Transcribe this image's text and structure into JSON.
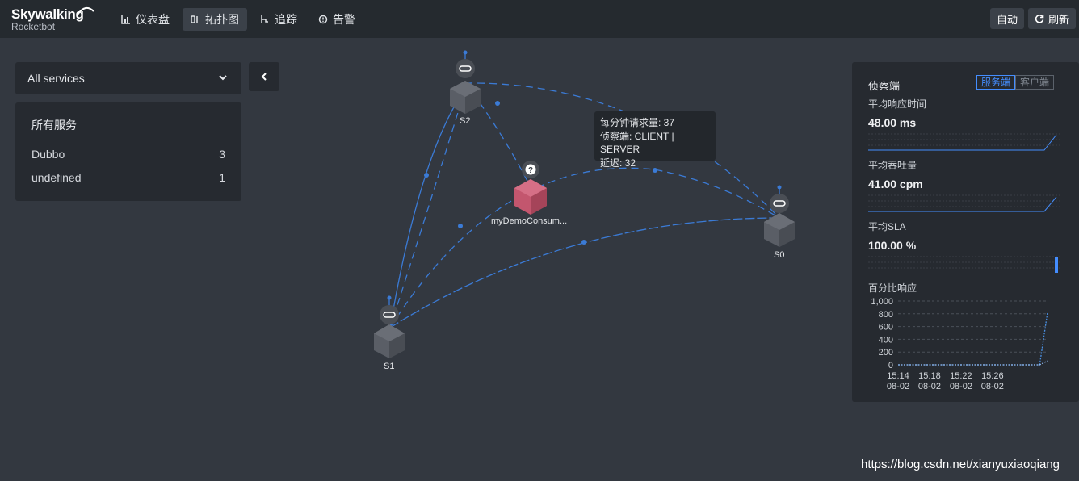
{
  "header": {
    "logo_name": "Skywalking",
    "logo_sub": "Rocketbot",
    "nav": [
      {
        "label": "仪表盘",
        "icon": "dashboard-icon"
      },
      {
        "label": "拓扑图",
        "icon": "topology-icon",
        "active": true
      },
      {
        "label": "追踪",
        "icon": "trace-icon"
      },
      {
        "label": "告警",
        "icon": "alarm-icon"
      }
    ],
    "auto_label": "自动",
    "refresh_label": "刷新"
  },
  "sidebar": {
    "service_select": "All services",
    "panel_title": "所有服务",
    "services": [
      {
        "name": "Dubbo",
        "count": "3"
      },
      {
        "name": "undefined",
        "count": "1"
      }
    ]
  },
  "topology": {
    "nodes": [
      {
        "label": "S2",
        "type": "dubbo"
      },
      {
        "label": "myDemoConsum...",
        "type": "unknown"
      },
      {
        "label": "S0",
        "type": "dubbo"
      },
      {
        "label": "S1",
        "type": "dubbo"
      }
    ],
    "tooltip": {
      "line1": "每分钟请求量: 37",
      "line2": "侦察端: CLIENT | SERVER",
      "line3": "延迟: 32"
    }
  },
  "detail_panel": {
    "title": "侦察端",
    "tabs": [
      "服务端",
      "客户端"
    ],
    "active_tab": "服务端",
    "metrics": [
      {
        "label": "平均响应时间",
        "value": "48.00 ms"
      },
      {
        "label": "平均吞吐量",
        "value": "41.00 cpm"
      },
      {
        "label": "平均SLA",
        "value": "100.00 %"
      }
    ],
    "percentile_title": "百分比响应"
  },
  "chart_data": {
    "type": "line",
    "title": "百分比响应",
    "y_ticks": [
      "1,000",
      "800",
      "600",
      "400",
      "200",
      "0"
    ],
    "ylim": [
      0,
      1000
    ],
    "x_ticks": [
      {
        "time": "15:14",
        "date": "08-02"
      },
      {
        "time": "15:18",
        "date": "08-02"
      },
      {
        "time": "15:22",
        "date": "08-02"
      },
      {
        "time": "15:26",
        "date": "08-02"
      }
    ],
    "x_range_minutes": [
      0,
      19
    ],
    "series": [
      {
        "values": [
          0,
          0,
          0,
          0,
          0,
          0,
          0,
          0,
          0,
          0,
          0,
          0,
          0,
          0,
          0,
          0,
          0,
          0,
          0,
          820
        ]
      },
      {
        "values": [
          0,
          0,
          0,
          0,
          0,
          0,
          0,
          0,
          0,
          0,
          0,
          0,
          0,
          0,
          0,
          0,
          0,
          0,
          0,
          60
        ]
      }
    ],
    "grid": true,
    "accent_color": "#4a90e2"
  },
  "watermark": "https://blog.csdn.net/xianyuxiaoqiang",
  "colors": {
    "accent": "#448dfe",
    "edge": "#3b7bd6",
    "node_unknown": "#c3566e",
    "node_dubbo": "#5a5e66"
  }
}
